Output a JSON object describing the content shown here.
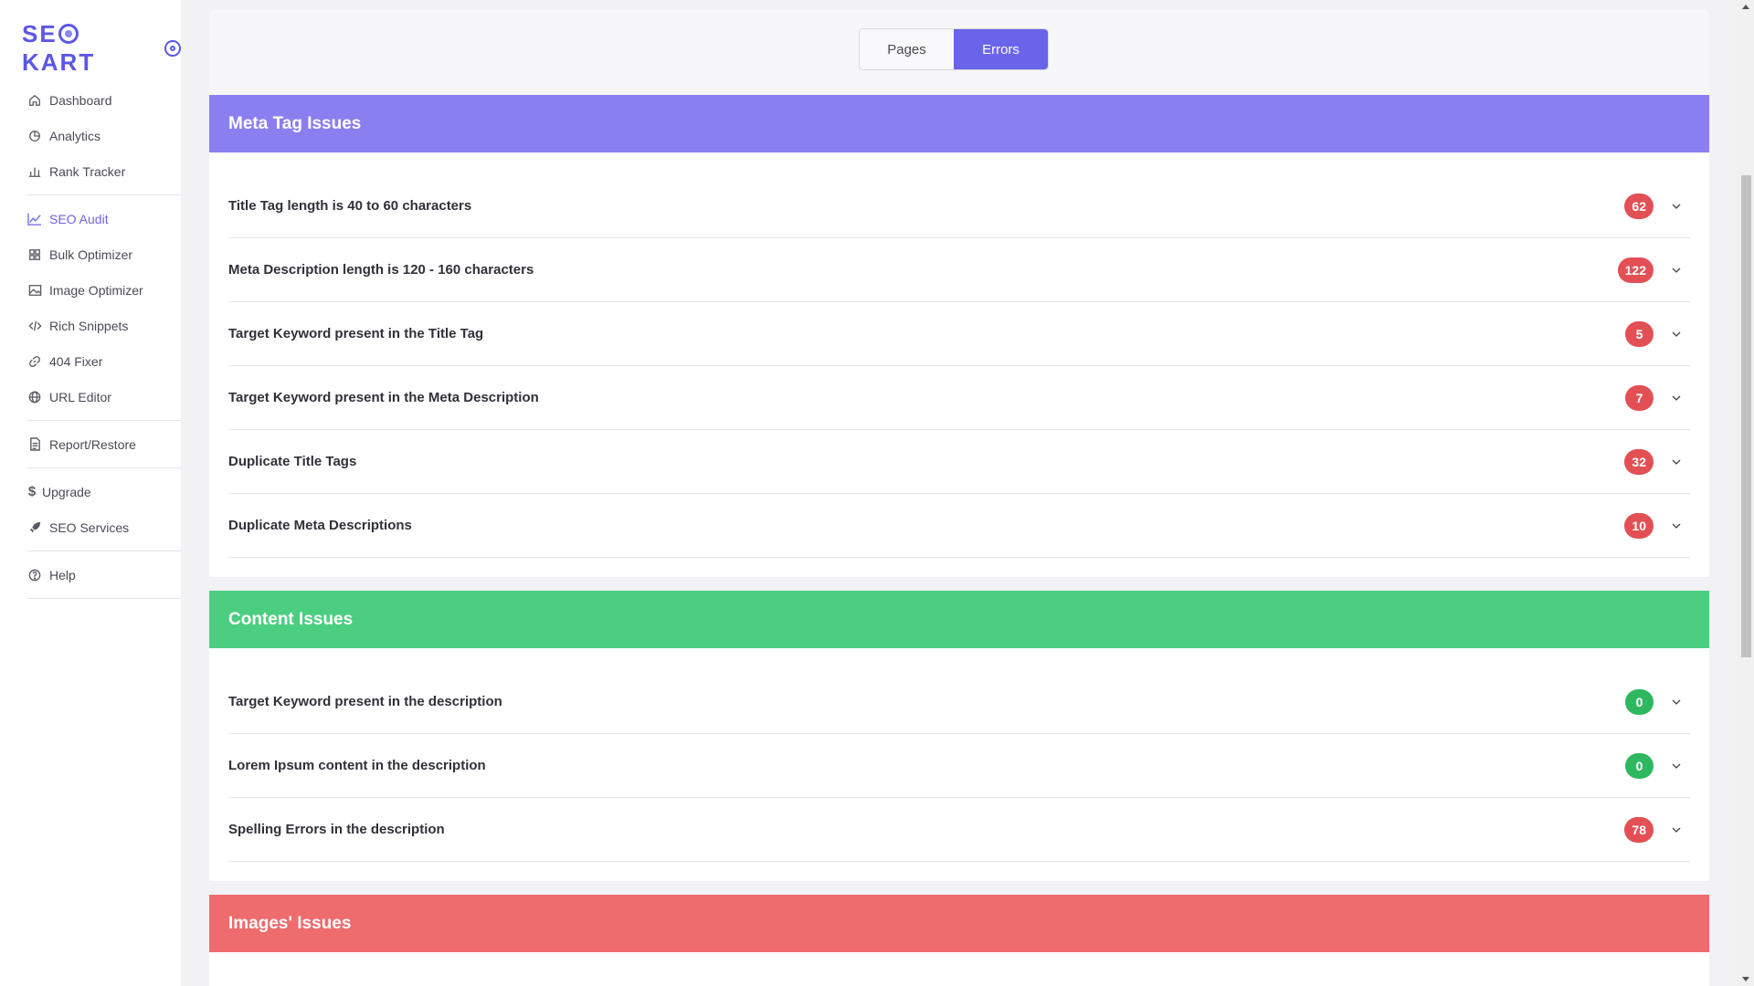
{
  "brand": {
    "name_prefix": "SE",
    "name_suffix": "KART"
  },
  "sidebar": {
    "items": [
      {
        "label": "Dashboard",
        "icon": "home-icon"
      },
      {
        "label": "Analytics",
        "icon": "pie-chart-icon"
      },
      {
        "label": "Rank Tracker",
        "icon": "bar-chart-icon"
      },
      {
        "label": "SEO Audit",
        "icon": "trend-line-icon",
        "active": true
      },
      {
        "label": "Bulk Optimizer",
        "icon": "grid-icon"
      },
      {
        "label": "Image Optimizer",
        "icon": "image-icon"
      },
      {
        "label": "Rich Snippets",
        "icon": "code-icon"
      },
      {
        "label": "404 Fixer",
        "icon": "link-icon"
      },
      {
        "label": "URL Editor",
        "icon": "globe-icon"
      },
      {
        "label": "Report/Restore",
        "icon": "document-icon"
      },
      {
        "label": "Upgrade",
        "icon": "dollar-icon"
      },
      {
        "label": "SEO Services",
        "icon": "rocket-icon"
      },
      {
        "label": "Help",
        "icon": "help-circle-icon"
      }
    ]
  },
  "tabs": {
    "pages": "Pages",
    "errors": "Errors",
    "active": "errors"
  },
  "sections": {
    "meta": {
      "title": "Meta Tag Issues",
      "color": "#8a7ff0",
      "rows": [
        {
          "label": "Title Tag length is 40 to 60 characters",
          "count": "62",
          "status": "error"
        },
        {
          "label": "Meta Description length is 120 - 160 characters",
          "count": "122",
          "status": "error"
        },
        {
          "label": "Target Keyword present in the Title Tag",
          "count": "5",
          "status": "error"
        },
        {
          "label": "Target Keyword present in the Meta Description",
          "count": "7",
          "status": "error"
        },
        {
          "label": "Duplicate Title Tags",
          "count": "32",
          "status": "error"
        },
        {
          "label": "Duplicate Meta Descriptions",
          "count": "10",
          "status": "error"
        }
      ]
    },
    "content": {
      "title": "Content Issues",
      "color": "#4cce81",
      "rows": [
        {
          "label": "Target Keyword present in the description",
          "count": "0",
          "status": "ok"
        },
        {
          "label": "Lorem Ipsum content in the description",
          "count": "0",
          "status": "ok"
        },
        {
          "label": "Spelling Errors in the description",
          "count": "78",
          "status": "error"
        }
      ]
    },
    "images": {
      "title": "Images' Issues",
      "color": "#ee6b6e"
    }
  }
}
